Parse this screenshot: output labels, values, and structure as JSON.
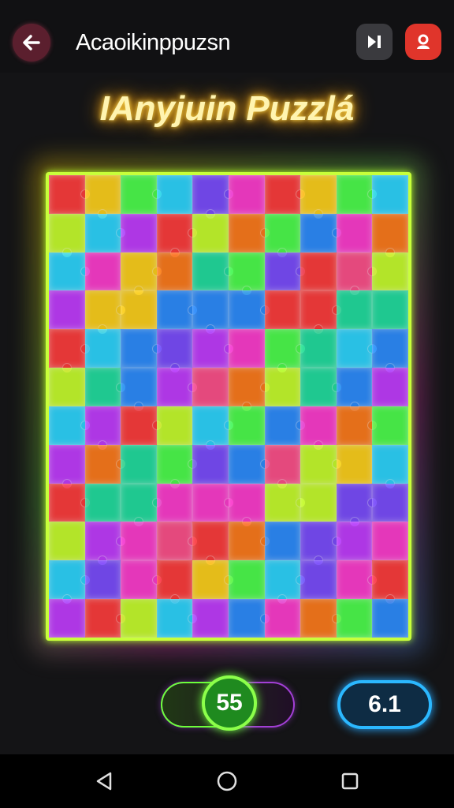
{
  "header": {
    "app_title": "Acaoikinppuzsn",
    "back_icon": "arrow-left-icon",
    "skip_icon": "skip-icon",
    "profile_icon": "user-icon"
  },
  "game": {
    "title": "IAnyjuin Puzzlá",
    "board": {
      "columns": 10,
      "rows": 12
    }
  },
  "footer": {
    "score": "55",
    "level": "6.1"
  },
  "navbar": {
    "back_icon": "triangle-back-icon",
    "home_icon": "circle-home-icon",
    "recents_icon": "square-recents-icon"
  },
  "colors": {
    "accent_green": "#8cff4a",
    "accent_blue": "#2bb8ff",
    "accent_red": "#e0352b",
    "title_glow": "#ffd84a"
  }
}
